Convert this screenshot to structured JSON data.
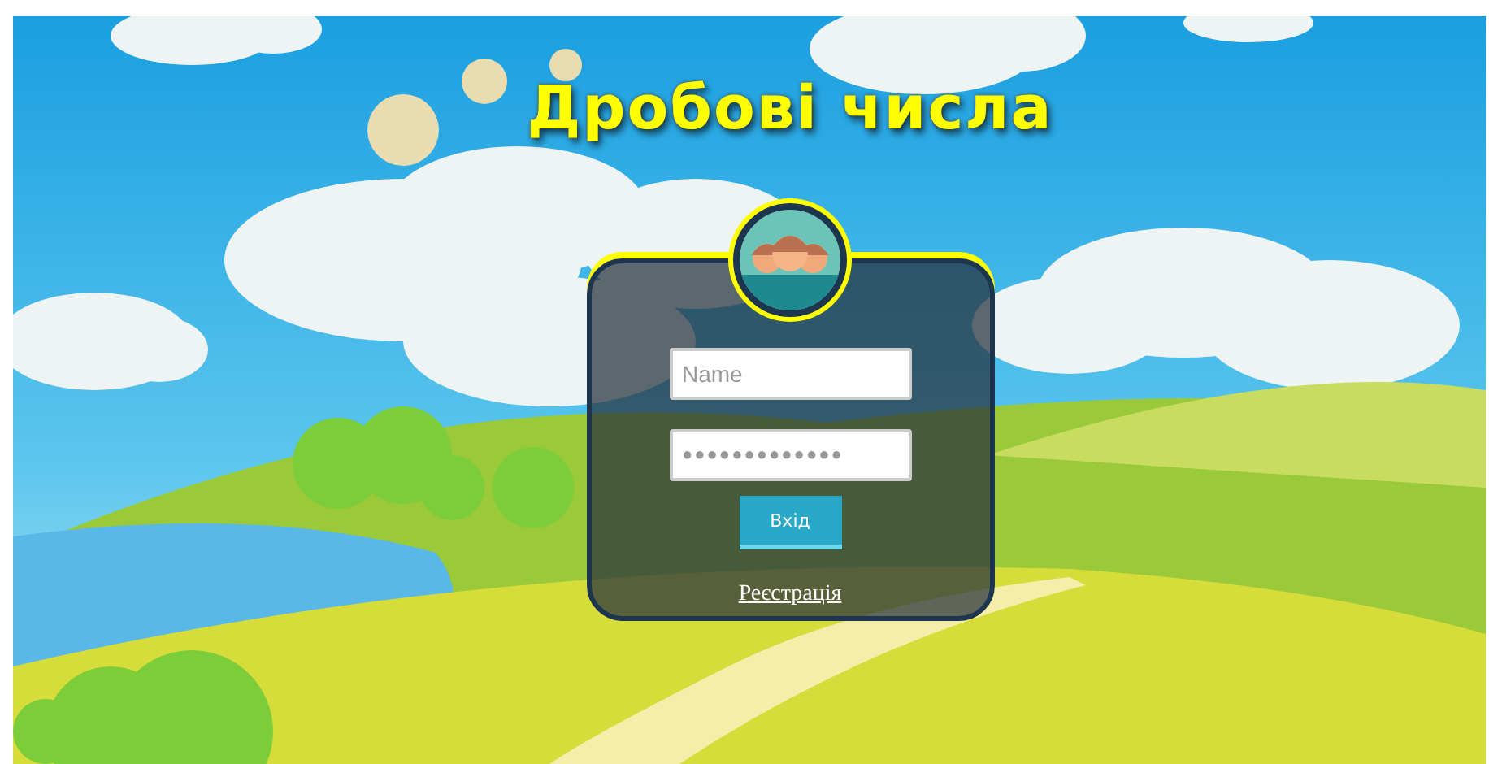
{
  "title": "Дробові числа",
  "login_form": {
    "name_field": {
      "placeholder": "Name"
    },
    "password_field": {
      "placeholder": "●●●●●●●●●●●●●"
    },
    "login_button": "Вхід",
    "register_link": "Реєстрація"
  }
}
